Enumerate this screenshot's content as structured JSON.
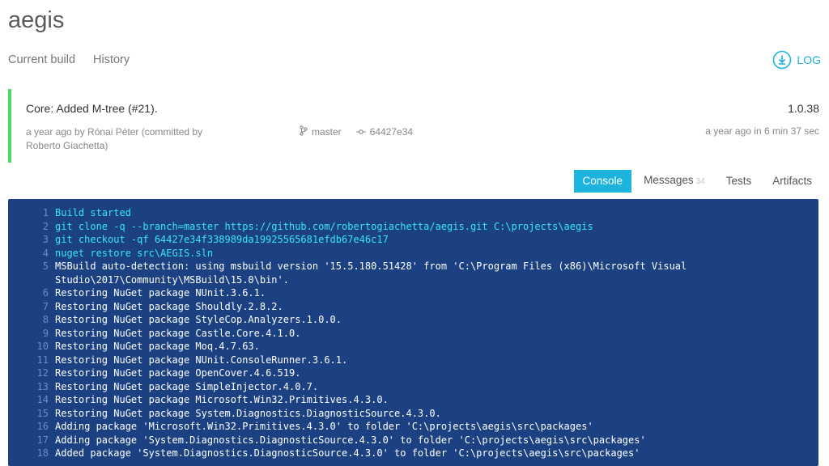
{
  "project": {
    "name": "aegis"
  },
  "nav": {
    "current_build": "Current build",
    "history": "History"
  },
  "log_button": {
    "label": "LOG",
    "icon": "download-circle-icon"
  },
  "build": {
    "message": "Core: Added M-tree (#21).",
    "version": "1.0.38",
    "author_line": "a year ago by Rónai Péter (committed by Roberto Giachetta)",
    "branch": "master",
    "commit": "64427e34",
    "timing": "a year ago in 6 min 37 sec",
    "status_color": "#4cd964"
  },
  "tabs": [
    {
      "label": "Console",
      "active": true
    },
    {
      "label": "Messages",
      "count": "34"
    },
    {
      "label": "Tests"
    },
    {
      "label": "Artifacts"
    }
  ],
  "console": {
    "lines": [
      {
        "n": "1",
        "text": "Build started",
        "cmd": true
      },
      {
        "n": "2",
        "text": "git clone -q --branch=master https://github.com/robertogiachetta/aegis.git C:\\projects\\aegis",
        "cmd": true
      },
      {
        "n": "3",
        "text": "git checkout -qf 64427e34f338989da19925565681efdb67e46c17",
        "cmd": true
      },
      {
        "n": "4",
        "text": "nuget restore src\\AEGIS.sln",
        "cmd": true
      },
      {
        "n": "5",
        "text": "MSBuild auto-detection: using msbuild version '15.5.180.51428' from 'C:\\Program Files (x86)\\Microsoft Visual Studio\\2017\\Community\\MSBuild\\15.0\\bin'."
      },
      {
        "n": "6",
        "text": "Restoring NuGet package NUnit.3.6.1."
      },
      {
        "n": "7",
        "text": "Restoring NuGet package Shouldly.2.8.2."
      },
      {
        "n": "8",
        "text": "Restoring NuGet package StyleCop.Analyzers.1.0.0."
      },
      {
        "n": "9",
        "text": "Restoring NuGet package Castle.Core.4.1.0."
      },
      {
        "n": "10",
        "text": "Restoring NuGet package Moq.4.7.63."
      },
      {
        "n": "11",
        "text": "Restoring NuGet package NUnit.ConsoleRunner.3.6.1."
      },
      {
        "n": "12",
        "text": "Restoring NuGet package OpenCover.4.6.519."
      },
      {
        "n": "13",
        "text": "Restoring NuGet package SimpleInjector.4.0.7."
      },
      {
        "n": "14",
        "text": "Restoring NuGet package Microsoft.Win32.Primitives.4.3.0."
      },
      {
        "n": "15",
        "text": "Restoring NuGet package System.Diagnostics.DiagnosticSource.4.3.0."
      },
      {
        "n": "16",
        "text": "Adding package 'Microsoft.Win32.Primitives.4.3.0' to folder 'C:\\projects\\aegis\\src\\packages'"
      },
      {
        "n": "17",
        "text": "Adding package 'System.Diagnostics.DiagnosticSource.4.3.0' to folder 'C:\\projects\\aegis\\src\\packages'"
      },
      {
        "n": "18",
        "text": "Added package 'System.Diagnostics.DiagnosticSource.4.3.0' to folder 'C:\\projects\\aegis\\src\\packages'"
      }
    ]
  }
}
